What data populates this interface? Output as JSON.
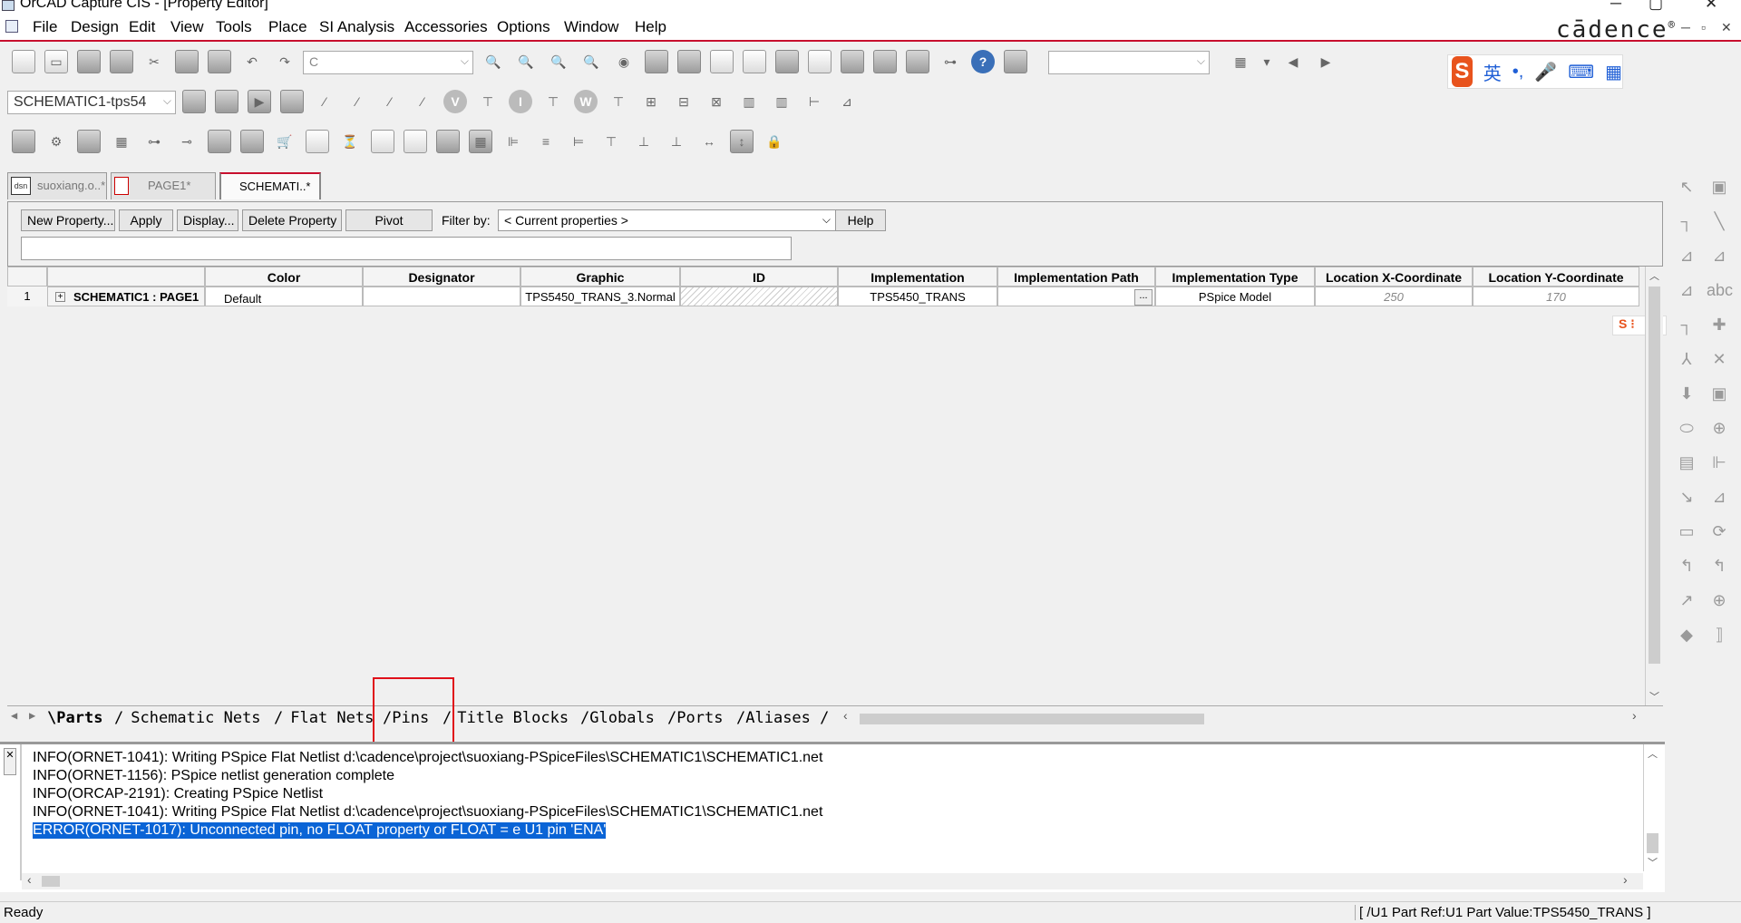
{
  "window": {
    "title": "OrCAD Capture CIS - [Property Editor]"
  },
  "menu": [
    "File",
    "Design",
    "Edit",
    "View",
    "Tools",
    "Place",
    "SI Analysis",
    "Accessories",
    "Options",
    "Window",
    "Help"
  ],
  "brand": {
    "logo": "cādence",
    "mark": "®"
  },
  "toolbar": {
    "search_value": "C",
    "schematic_select": "SCHEMATIC1-tps54",
    "ime_lang": "英",
    "ime_punct": "•,"
  },
  "doc_tabs": [
    {
      "label": "suoxiang.o..*",
      "icon": "project-icon"
    },
    {
      "label": "PAGE1*",
      "icon": "schematic-page-icon"
    },
    {
      "label": "SCHEMATI..*",
      "icon": "property-editor-icon",
      "active": true
    }
  ],
  "property_bar": {
    "new_property": "New Property...",
    "apply": "Apply",
    "display": "Display...",
    "delete_property": "Delete Property",
    "pivot": "Pivot",
    "filter_label": "Filter by:",
    "filter_value": "< Current properties >",
    "help": "Help"
  },
  "grid": {
    "columns": [
      "Color",
      "Designator",
      "Graphic",
      "ID",
      "Implementation",
      "Implementation Path",
      "Implementation Type",
      "Location X-Coordinate",
      "Location Y-Coordinate"
    ],
    "row": {
      "number": "1",
      "expand": "+",
      "name": "SCHEMATIC1 : PAGE1",
      "cells": [
        "Default",
        "",
        "TPS5450_TRANS_3.Normal",
        "",
        "TPS5450_TRANS",
        "",
        "PSpice Model",
        "250",
        "170"
      ],
      "path_button": "..."
    }
  },
  "sheet_tabs": [
    "Parts",
    "Schematic Nets",
    "Flat Nets",
    "Pins",
    "Title Blocks",
    "Globals",
    "Ports",
    "Aliases"
  ],
  "output": {
    "lines": [
      "INFO(ORNET-1041): Writing PSpice Flat Netlist d:\\cadence\\project\\suoxiang-PSpiceFiles\\SCHEMATIC1\\SCHEMATIC1.net",
      "INFO(ORNET-1156): PSpice netlist generation complete",
      "INFO(ORCAP-2191): Creating PSpice Netlist",
      "INFO(ORNET-1041): Writing PSpice Flat Netlist d:\\cadence\\project\\suoxiang-PSpiceFiles\\SCHEMATIC1\\SCHEMATIC1.net"
    ],
    "error": "ERROR(ORNET-1017): Unconnected pin, no FLOAT property or FLOAT = e U1 pin 'ENA'"
  },
  "status": {
    "left": "Ready",
    "right": "[ /U1 Part Ref:U1 Part Value:TPS5450_TRANS ]"
  },
  "colors": {
    "accent": "#c8102e",
    "selection": "#0a64d6",
    "highlight_box": "#e0101a"
  }
}
